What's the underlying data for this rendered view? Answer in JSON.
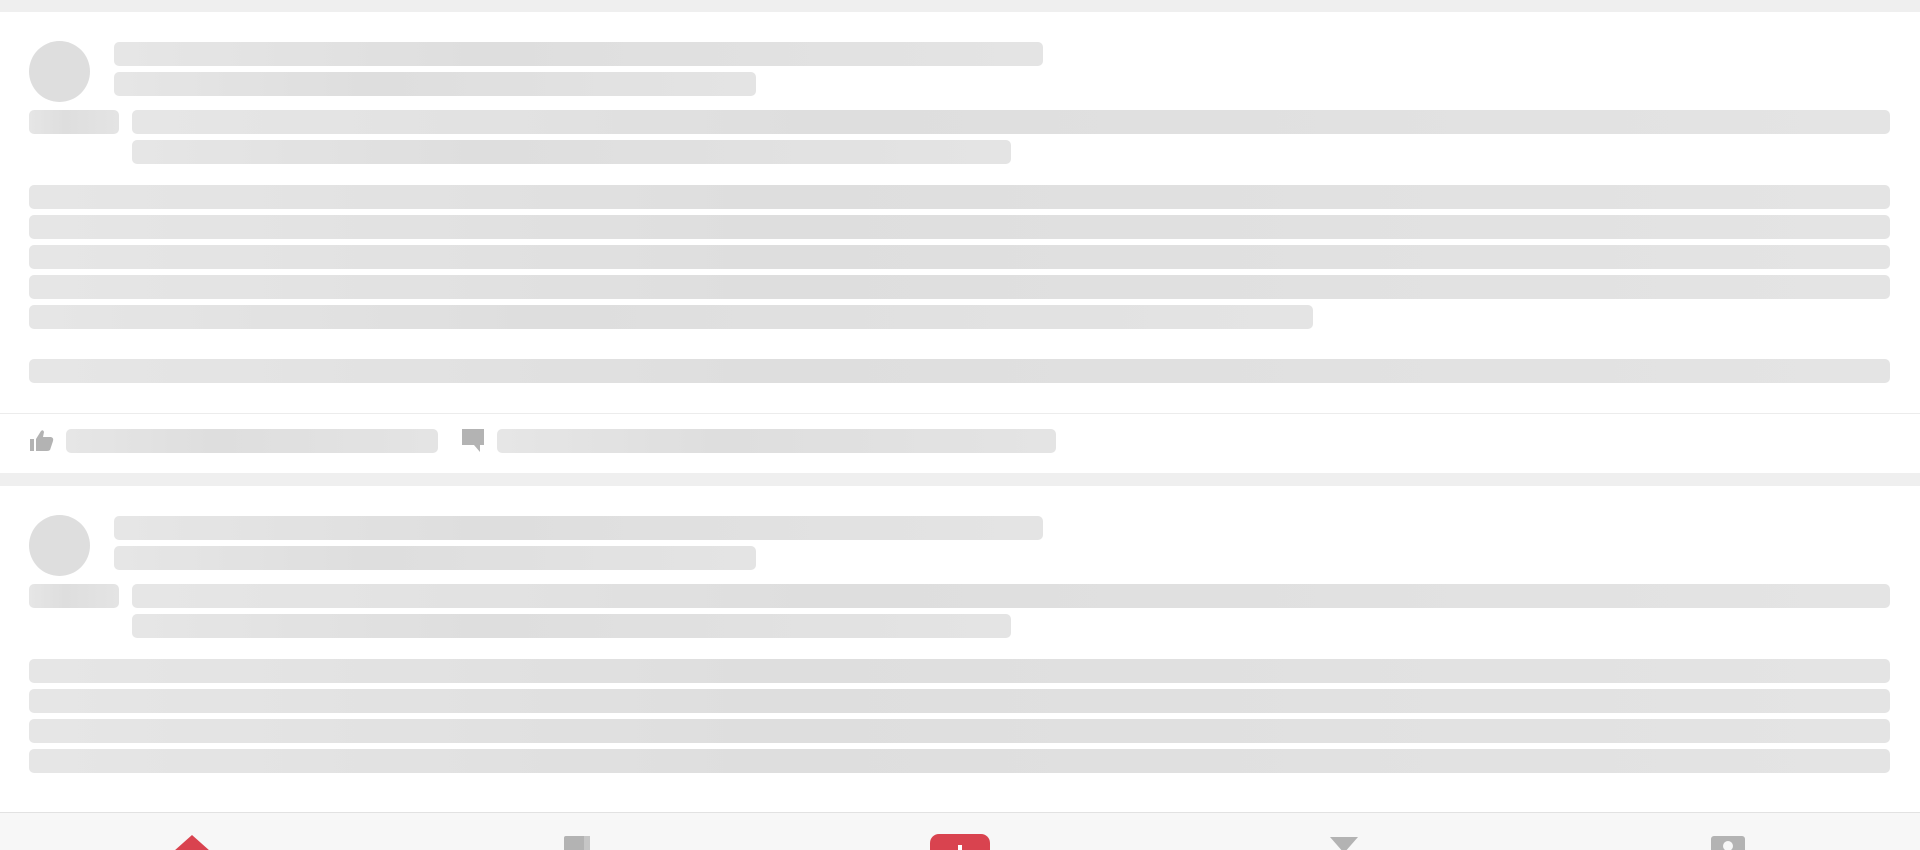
{
  "feed": {
    "state": "loading",
    "posts": [
      {
        "kind": "skeleton-post",
        "has_actions": true
      },
      {
        "kind": "skeleton-post",
        "has_actions": false
      }
    ],
    "actions": {
      "like_icon": "thumbs-up-icon",
      "comment_icon": "comment-icon"
    }
  },
  "bottom_nav": {
    "items": [
      {
        "icon": "home-icon",
        "active": true
      },
      {
        "icon": "bookmark-icon",
        "active": false
      },
      {
        "icon": "compose-icon",
        "active": false,
        "highlight": true
      },
      {
        "icon": "notification-icon",
        "active": false
      },
      {
        "icon": "profile-icon",
        "active": false
      }
    ],
    "active_color": "#d9434f",
    "inactive_color": "#b3b3b3"
  },
  "colors": {
    "background": "#efefef",
    "card": "#ffffff",
    "skeleton": "#dedede",
    "icon_gray": "#b3b3b3",
    "accent": "#d9434f"
  }
}
